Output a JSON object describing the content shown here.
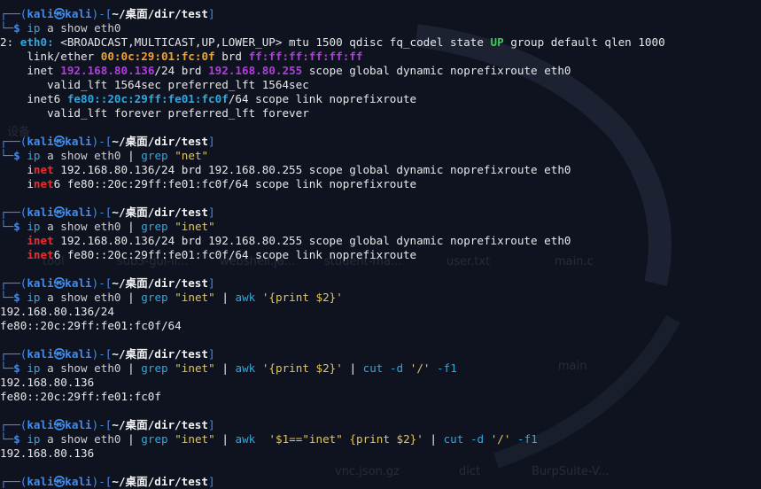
{
  "prompt": {
    "user": "kali",
    "host": "kali",
    "path": "~/桌面/dir/test",
    "path_dir": "/dir/test"
  },
  "colors": {
    "prompt_blue": "#3f8cf0",
    "command_cyan": "#2fa8e0",
    "match_red": "#ef2b2b",
    "ip_purple": "#b13ddc",
    "mac_orange": "#f2a32b",
    "up_green": "#35d04d",
    "string_yellow": "#e1c65a",
    "background": "#0f1320"
  },
  "desktop_watermark_labels": [
    "tool",
    "sub3-gui-li...",
    "webshell.ja...",
    "student-ma...",
    "user.txt",
    "main.c",
    "main",
    "dict",
    "BurpSuite-V...",
    "vnc.json.gz",
    "设备"
  ],
  "blocks": [
    {
      "command": [
        "ip",
        " a show eth0"
      ],
      "output": [
        [
          [
            "2: ",
            ""
          ],
          [
            "eth0:",
            "ifname"
          ],
          [
            " <BROADCAST,MULTICAST,UP,LOWER_UP> mtu 1500 qdisc fq_codel state ",
            ""
          ],
          [
            "UP",
            "up"
          ],
          [
            " group default qlen 1000",
            ""
          ]
        ],
        [
          [
            "    link/ether ",
            ""
          ],
          [
            "00:0c:29:01:fc:0f",
            "orange"
          ],
          [
            " brd ",
            ""
          ],
          [
            "ff:ff:ff:ff:ff:ff",
            "purple"
          ]
        ],
        [
          [
            "    inet ",
            ""
          ],
          [
            "192.168.80.136",
            "purple"
          ],
          [
            "/24 brd ",
            ""
          ],
          [
            "192.168.80.255",
            "purple"
          ],
          [
            " scope global dynamic noprefixroute eth0",
            ""
          ]
        ],
        [
          [
            "       valid_lft 1564sec preferred_lft 1564sec",
            ""
          ]
        ],
        [
          [
            "    inet6 ",
            ""
          ],
          [
            "fe80::20c:29ff:fe01:fc0f",
            "cyan-b"
          ],
          [
            "/64 scope link noprefixroute",
            ""
          ]
        ],
        [
          [
            "       valid_lft forever preferred_lft forever",
            ""
          ]
        ]
      ]
    },
    {
      "command": [
        "ip",
        " a show eth0 ",
        "|",
        " ",
        "grep",
        " ",
        "\"net\""
      ],
      "output": [
        [
          [
            "    i",
            ""
          ],
          [
            "net",
            "red"
          ],
          [
            " 192.168.80.136/24 brd 192.168.80.255 scope global dynamic noprefixroute eth0",
            ""
          ]
        ],
        [
          [
            "    i",
            ""
          ],
          [
            "net",
            "red"
          ],
          [
            "6 fe80::20c:29ff:fe01:fc0f/64 scope link noprefixroute",
            ""
          ]
        ]
      ]
    },
    {
      "command": [
        "ip",
        " a show eth0 ",
        "|",
        " ",
        "grep",
        " ",
        "\"inet\""
      ],
      "output": [
        [
          [
            "    ",
            ""
          ],
          [
            "inet",
            "red"
          ],
          [
            " 192.168.80.136/24 brd 192.168.80.255 scope global dynamic noprefixroute eth0",
            ""
          ]
        ],
        [
          [
            "    ",
            ""
          ],
          [
            "inet",
            "red"
          ],
          [
            "6 fe80::20c:29ff:fe01:fc0f/64 scope link noprefixroute",
            ""
          ]
        ]
      ]
    },
    {
      "command": [
        "ip",
        " a show eth0 ",
        "|",
        " ",
        "grep",
        " ",
        "\"inet\"",
        " ",
        "|",
        " ",
        "awk",
        " ",
        "'{print $2}'"
      ],
      "output": [
        [
          [
            "192.168.80.136/24",
            ""
          ]
        ],
        [
          [
            "fe80::20c:29ff:fe01:fc0f/64",
            ""
          ]
        ]
      ]
    },
    {
      "command": [
        "ip",
        " a show eth0 ",
        "|",
        " ",
        "grep",
        " ",
        "\"inet\"",
        " ",
        "|",
        " ",
        "awk",
        " ",
        "'{print $2}'",
        " ",
        "|",
        " ",
        "cut",
        " ",
        "-d",
        " ",
        "'/'",
        " ",
        "-f1"
      ],
      "output": [
        [
          [
            "192.168.80.136",
            ""
          ]
        ],
        [
          [
            "fe80::20c:29ff:fe01:fc0f",
            ""
          ]
        ]
      ]
    },
    {
      "command": [
        "ip",
        " a show eth0 ",
        "|",
        " ",
        "grep",
        " ",
        "\"inet\"",
        " ",
        "|",
        " ",
        "awk",
        "  ",
        "'$1==\"inet\" {print $2}'",
        " ",
        "|",
        " ",
        "cut",
        " ",
        "-d",
        " ",
        "'/'",
        " ",
        "-f1"
      ],
      "output": [
        [
          [
            "192.168.80.136",
            ""
          ]
        ]
      ]
    },
    {
      "command": [],
      "output": []
    }
  ]
}
